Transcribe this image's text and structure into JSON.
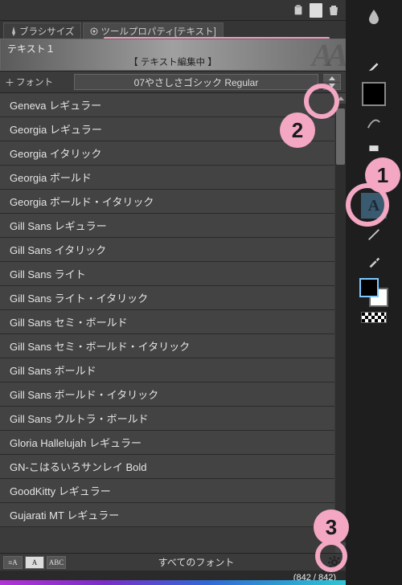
{
  "tabs": [
    {
      "label": "ブラシサイズ"
    },
    {
      "label": "ツールプロパティ[テキスト]"
    }
  ],
  "title": {
    "name": "テキスト１",
    "sub": "【 テキスト編集中 】"
  },
  "font": {
    "label": "フォント",
    "selected": "07やさしさゴシック Regular"
  },
  "font_list": [
    "Geneva レギュラー",
    "Georgia レギュラー",
    "Georgia イタリック",
    "Georgia ボールド",
    "Georgia ボールド・イタリック",
    "Gill Sans レギュラー",
    "Gill Sans イタリック",
    "Gill Sans ライト",
    "Gill Sans ライト・イタリック",
    "Gill Sans セミ・ボールド",
    "Gill Sans セミ・ボールド・イタリック",
    "Gill Sans ボールド",
    "Gill Sans ボールド・イタリック",
    "Gill Sans ウルトラ・ボールド",
    "Gloria Hallelujah レギュラー",
    "GN-こはるいろサンレイ Bold",
    "GoodKitty レギュラー",
    "Gujarati MT レギュラー"
  ],
  "bottom": {
    "modes": [
      "≡A",
      "A",
      "ABC"
    ],
    "label": "すべてのフォント"
  },
  "status": "(842 / 842)",
  "annotations": {
    "b1": "1",
    "b2": "2",
    "b3": "3"
  }
}
